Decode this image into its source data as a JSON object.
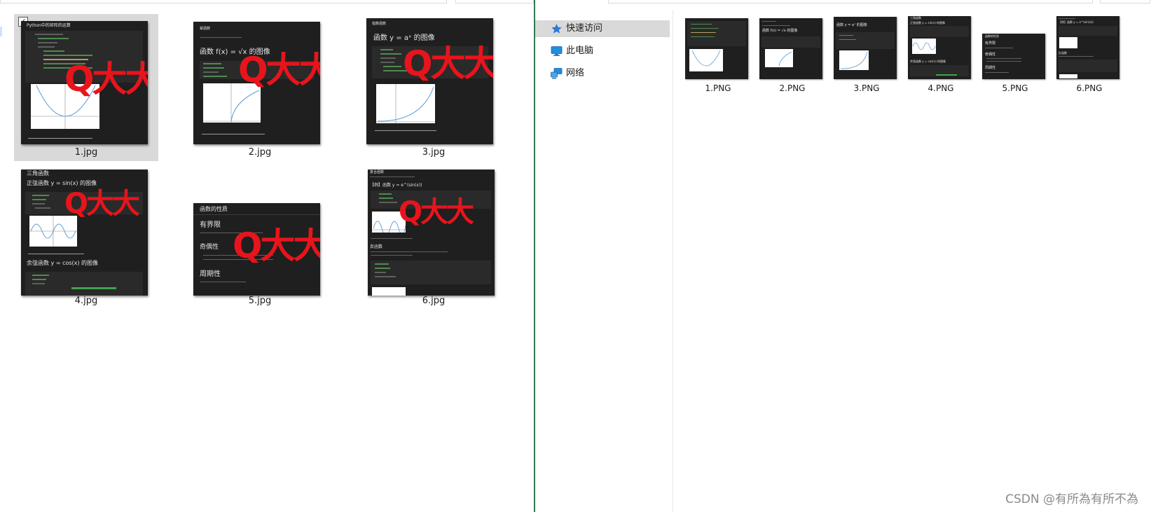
{
  "left_pane": {
    "files": [
      {
        "name": "1.jpg",
        "selected": true,
        "header": "Python中的矩阵的运算",
        "watermark": "Q大大",
        "caption": "<sympy.plotting.plot.Plot at 0x…>"
      },
      {
        "name": "2.jpg",
        "selected": false,
        "header": "幂函数",
        "formula": "函数 f(x) = √x 的图像",
        "watermark": "Q大大",
        "caption": "<sympy.plotting.plot.Plot at 0x…>"
      },
      {
        "name": "3.jpg",
        "selected": false,
        "header": "指数函数",
        "formula": "函数 y = aˣ 的图像",
        "watermark": "Q大大",
        "caption": "<sympy.plotting.plot.Plot at 0x…>"
      },
      {
        "name": "4.jpg",
        "selected": false,
        "header": "三角函数",
        "formula": "正弦函数 y = sin(x) 的图像",
        "formula2": "余弦函数 y = cos(x) 的图像",
        "watermark": "Q大大",
        "caption": "<sympy.plotting.plot.Plot at 0x…>"
      },
      {
        "name": "5.jpg",
        "selected": false,
        "header": "函数的性质",
        "section1": "有界限",
        "section2": "奇偶性",
        "section3": "周期性",
        "watermark": "Q大大"
      },
      {
        "name": "6.jpg",
        "selected": false,
        "header": "复合函数",
        "formula": "【例】函数 y = e^(sin(x))",
        "section": "反函数",
        "watermark": "Q大大"
      }
    ]
  },
  "navigation": {
    "items": [
      {
        "label": "快速访问",
        "icon": "star-pin-icon",
        "active": true
      },
      {
        "label": "此电脑",
        "icon": "computer-icon",
        "active": false
      },
      {
        "label": "网络",
        "icon": "network-icon",
        "active": false
      }
    ]
  },
  "right_pane": {
    "files": [
      {
        "name": "1.PNG"
      },
      {
        "name": "2.PNG"
      },
      {
        "name": "3.PNG"
      },
      {
        "name": "4.PNG"
      },
      {
        "name": "5.PNG"
      },
      {
        "name": "6.PNG"
      }
    ]
  },
  "watermark_text": "CSDN @有所為有所不為",
  "colors": {
    "selection": "#d9d9d9",
    "thumbnail_bg": "#1f1f1f",
    "watermark_red": "#e8141c",
    "splitter_green": "#2e7d4f",
    "quick_access_blue": "#2a7bd6"
  }
}
